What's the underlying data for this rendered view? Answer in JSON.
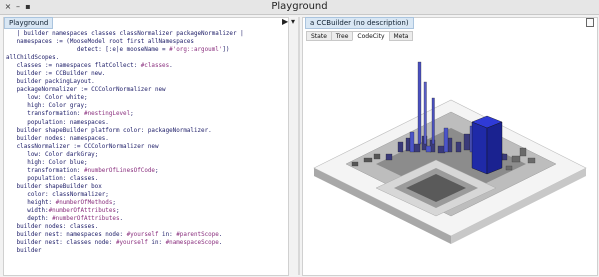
{
  "window": {
    "title": "Playground"
  },
  "left_tab": {
    "label": "Playground"
  },
  "right_tab": {
    "label": "a CCBuilder (no description)"
  },
  "right_subtabs": [
    "State",
    "Tree",
    "CodeCity",
    "Meta"
  ],
  "active_subtab": "CodeCity",
  "code_lines": [
    "   | builder namespaces classes classNormalizer packageNormalizer |",
    "   namespaces := (MooseModel root first allNamespaces",
    "                    detect: [:e|e mooseName = #'org::argouml'])",
    "allChildScopes.",
    "   classes := namespaces flatCollect: #classes.",
    "   builder := CCBuilder new.",
    "   builder packingLayout.",
    "   packageNormalizer := CCColorNormalizer new",
    "      low: Color white;",
    "      high: Color gray;",
    "      transformation: #nestingLevel;",
    "      population: namespaces.",
    "   builder shapeBuilder platform color: packageNormalizer.",
    "   builder nodes: namespaces.",
    "   classNormalizer := CCColorNormalizer new",
    "      low: Color darkGray;",
    "      high: Color blue;",
    "      transformation: #numberOfLinesOfCode;",
    "      population: classes.",
    "   builder shapeBuilder box",
    "      color: classNormalizer;",
    "      height: #numberOfMethods;",
    "      width:#numberOfAttributes;",
    "      depth: #numberOfAttributes.",
    "   builder nodes: classes.",
    "   builder nest: namespaces node: #yourself in: #parentScope.",
    "   builder nest: classes node: #yourself in: #namespaceScope.",
    "   builder"
  ],
  "colors": {
    "keyword": "#20206a",
    "symbol": "#8a2f7e",
    "tab_bg": "#d9e7f4"
  },
  "icons": [
    "close-icon",
    "minimize-icon",
    "maximize-icon",
    "play-icon",
    "dropdown-icon",
    "inspect-icon"
  ]
}
